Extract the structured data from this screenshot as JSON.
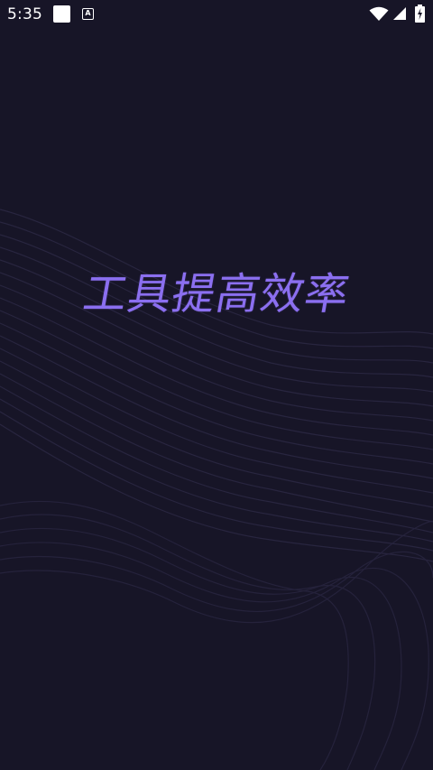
{
  "status_bar": {
    "time": "5:35",
    "notification_icons": [
      "square-icon",
      "text-a-icon"
    ],
    "system_icons": [
      "wifi-icon",
      "signal-icon",
      "battery-charging-icon"
    ]
  },
  "main": {
    "headline": "工具提高效率"
  },
  "colors": {
    "background": "#171527",
    "accent": "#8b6ff0",
    "wave_lines": "#2a2742"
  }
}
